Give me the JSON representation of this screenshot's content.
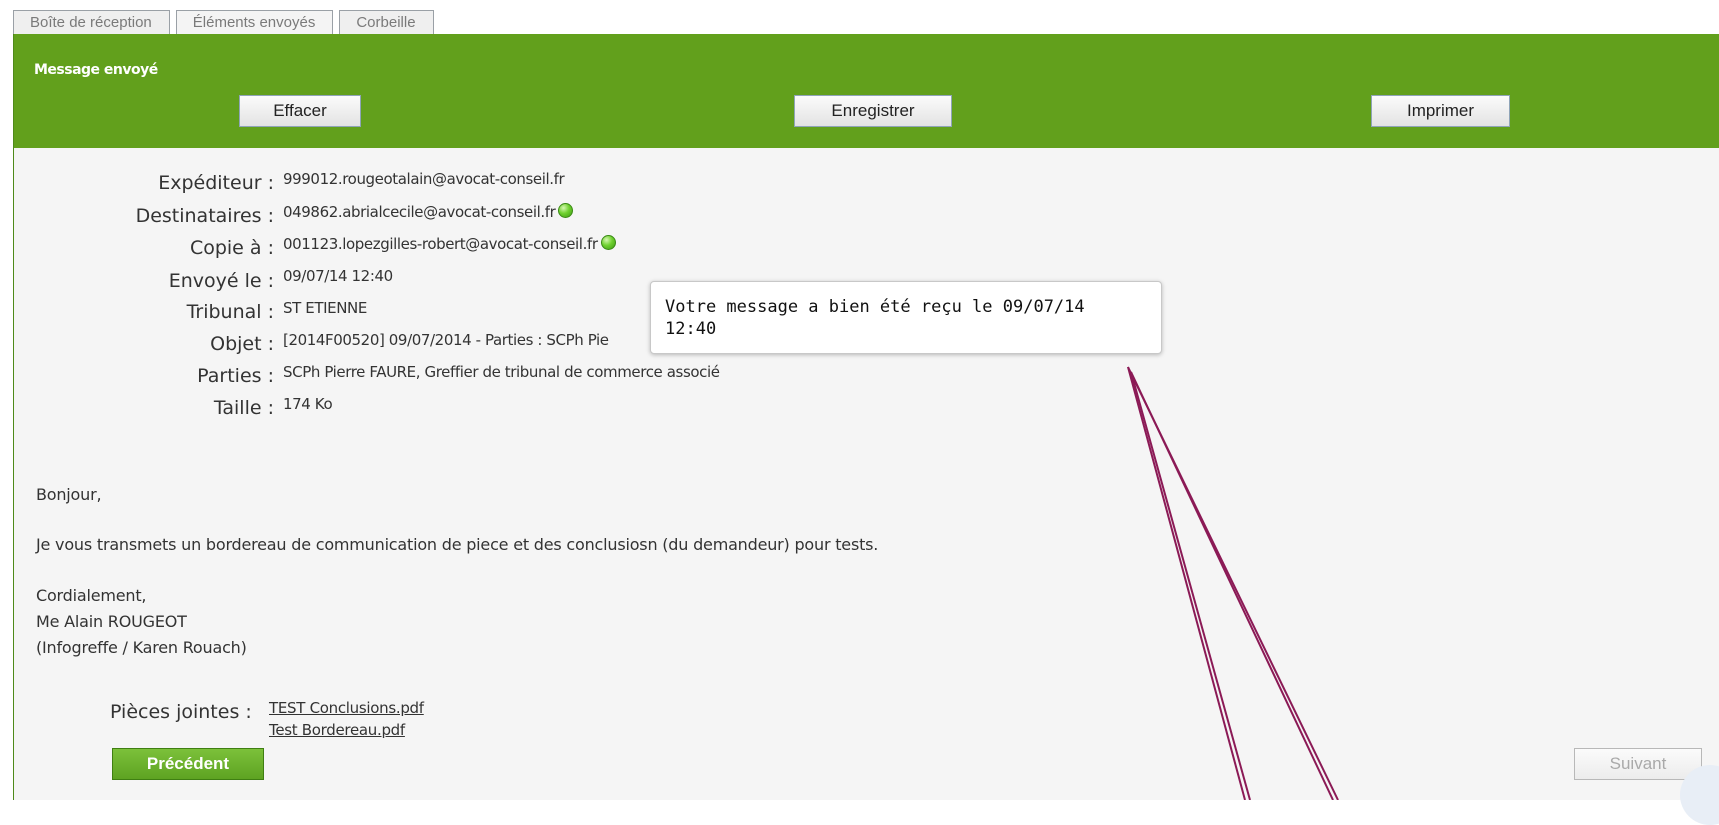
{
  "tabs": [
    {
      "label": "Boîte de réception"
    },
    {
      "label": "Éléments envoyés",
      "active": true
    },
    {
      "label": "Corbeille"
    }
  ],
  "header": {
    "title": "Message envoyé",
    "buttons": {
      "delete": "Effacer",
      "save": "Enregistrer",
      "print": "Imprimer"
    }
  },
  "meta": {
    "sender_label": "Expéditeur :",
    "sender": "999012.rougeotalain@avocat-conseil.fr",
    "recipients_label": "Destinataires :",
    "recipients": "049862.abrialcecile@avocat-conseil.fr",
    "cc_label": "Copie à :",
    "cc": "001123.lopezgilles-robert@avocat-conseil.fr",
    "sent_label": "Envoyé le :",
    "sent": "09/07/14 12:40",
    "court_label": "Tribunal :",
    "court": "ST ETIENNE",
    "subject_label": "Objet :",
    "subject": "[2014F00520] 09/07/2014 - Parties : SCPh Pie",
    "parties_label": "Parties :",
    "parties": "SCPh Pierre FAURE, Greffier de tribunal de commerce associé",
    "size_label": "Taille :",
    "size": "174 Ko",
    "status_color": "#5cc420"
  },
  "tooltip": {
    "text": "Votre message a bien été reçu le 09/07/14\n12:40"
  },
  "body": {
    "greeting": "Bonjour,",
    "text": "Je vous transmets un bordereau de communication de piece et des conclusiosn (du demandeur) pour tests.",
    "closing": "Cordialement,",
    "signature_1": "Me Alain ROUGEOT",
    "signature_2": "(Infogreffe / Karen Rouach)"
  },
  "attachments": {
    "label": "Pièces jointes :",
    "files": [
      "TEST Conclusions.pdf",
      "Test Bordereau.pdf"
    ]
  },
  "nav": {
    "prev": "Précédent",
    "next": "Suivant"
  },
  "colors": {
    "header_green": "#62a01c",
    "annotation": "#8b1a56"
  }
}
